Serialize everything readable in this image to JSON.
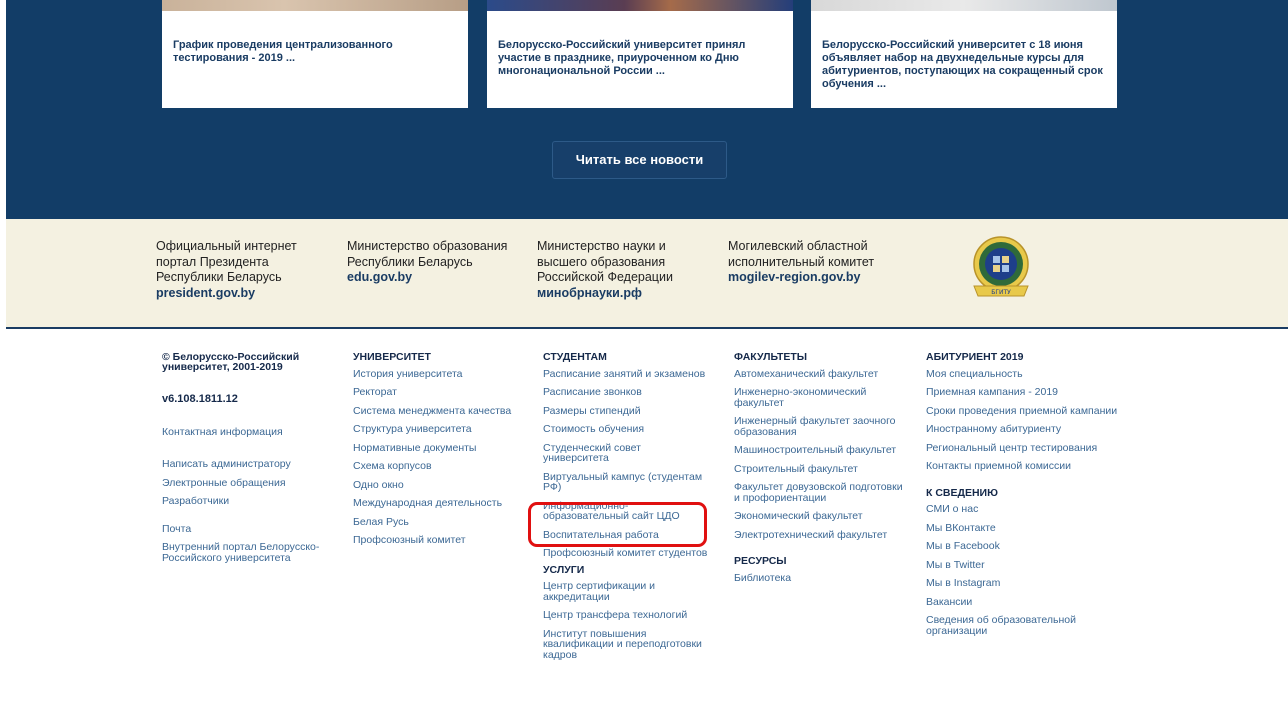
{
  "news": {
    "cards": [
      {
        "title": "График проведения централизованного тестирования - 2019 ..."
      },
      {
        "title": "Белорусско-Российский университет принял участие в празднике, приуроченном ко Дню многонациональной России ..."
      },
      {
        "title": "Белорусско-Российский университет с 18 июня объявляет набор на двухнедельные курсы для абитуриентов, поступающих на сокращенный срок обучения ..."
      }
    ],
    "all_news_label": "Читать все новости"
  },
  "partners": [
    {
      "text": "Официальный интернет портал Президента Республики Беларусь",
      "link": "president.gov.by"
    },
    {
      "text": "Министерство образования Республики Беларусь",
      "link": "edu.gov.by"
    },
    {
      "text": "Министерство науки и высшего образования Российской Федерации",
      "link": "минобрнауки.рф"
    },
    {
      "text": "Могилевский областной исполнительный комитет",
      "link": "mogilev-region.gov.by"
    }
  ],
  "emblem_label": "БГИТУ",
  "footer": {
    "col1": {
      "copyright": "© Белорусско-Российский университет, 2001-2019",
      "version": "v6.108.1811.12",
      "links": [
        "Контактная информация",
        "Написать администратору",
        "Электронные обращения",
        "Разработчики",
        "Почта",
        "Внутренний портал Белорусско-Российского университета"
      ]
    },
    "col2": {
      "heading": "УНИВЕРСИТЕТ",
      "links": [
        "История университета",
        "Ректорат",
        "Система менеджмента качества",
        "Структура университета",
        "Нормативные документы",
        "Схема корпусов",
        "Одно окно",
        "Международная деятельность",
        "Белая Русь",
        "Профсоюзный комитет"
      ]
    },
    "col3": {
      "heading": "СТУДЕНТАМ",
      "links": [
        "Расписание занятий и экзаменов",
        "Расписание звонков",
        "Размеры стипендий",
        "Стоимость обучения",
        "Студенческий совет университета",
        "Виртуальный кампус (студентам РФ)",
        "Информационно-образовательный сайт ЦДО",
        "Воспитательная работа",
        "Профсоюзный комитет студентов"
      ],
      "heading2": "УСЛУГИ",
      "links2": [
        "Центр сертификации и аккредитации",
        "Центр трансфера технологий",
        "Институт повышения квалификации и переподготовки кадров"
      ]
    },
    "col4": {
      "heading": "ФАКУЛЬТЕТЫ",
      "links": [
        "Автомеханический факультет",
        "Инженерно-экономический факультет",
        "Инженерный факультет заочного образования",
        "Машиностроительный факультет",
        "Строительный факультет",
        "Факультет довузовской подготовки и профориентации",
        "Экономический факультет",
        "Электротехнический факультет"
      ],
      "heading2": "РЕСУРСЫ",
      "links2": [
        "Библиотека"
      ]
    },
    "col5": {
      "heading": "АБИТУРИЕНТ 2019",
      "links": [
        "Моя специальность",
        "Приемная кампания - 2019",
        "Сроки проведения приемной кампании",
        "Иностранному абитуриенту",
        "Региональный центр тестирования",
        "Контакты приемной комиссии"
      ],
      "heading2": "К СВЕДЕНИЮ",
      "links2": [
        "СМИ о нас",
        "Мы ВКонтакте",
        "Мы в Facebook",
        "Мы в Twitter",
        "Мы в Instagram",
        "Вакансии",
        "Сведения об образовательной организации"
      ]
    }
  },
  "colors": {
    "news_bg": "#123d67",
    "partners_bg": "#f4f1e1",
    "link": "#3c6894",
    "highlight": "#e01010"
  }
}
